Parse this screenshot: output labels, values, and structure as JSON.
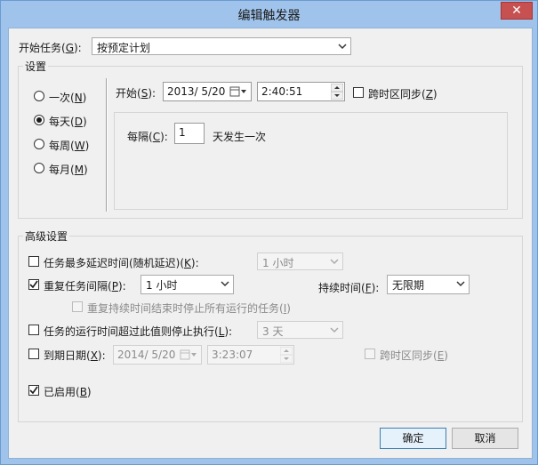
{
  "window": {
    "title": "编辑触发器",
    "close_glyph": "✕"
  },
  "begin_task": {
    "label": "开始任务(",
    "key": "G",
    "suffix": "):",
    "value": "按预定计划"
  },
  "settings": {
    "title": "设置",
    "radios": [
      {
        "label": "一次(",
        "key": "N",
        "suffix": ")",
        "checked": false
      },
      {
        "label": "每天(",
        "key": "D",
        "suffix": ")",
        "checked": true
      },
      {
        "label": "每周(",
        "key": "W",
        "suffix": ")",
        "checked": false
      },
      {
        "label": "每月(",
        "key": "M",
        "suffix": ")",
        "checked": false
      }
    ],
    "start": {
      "label": "开始(",
      "key": "S",
      "suffix": "):",
      "date": "2013/  5/20",
      "time": "2:40:51",
      "sync_label": "跨时区同步(",
      "sync_key": "Z",
      "sync_suffix": ")",
      "sync_checked": false
    },
    "recur": {
      "label": "每隔(",
      "key": "C",
      "suffix": "):",
      "value": "1",
      "unit": "天发生一次"
    }
  },
  "advanced": {
    "title": "高级设置",
    "delay": {
      "label": "任务最多延迟时间(随机延迟)(",
      "key": "K",
      "suffix": "):",
      "value": "1 小时",
      "checked": false
    },
    "repeat": {
      "label": "重复任务间隔(",
      "key": "P",
      "suffix": "):",
      "value": "1 小时",
      "checked": true,
      "duration_label": "持续时间(",
      "duration_key": "F",
      "duration_suffix": "):",
      "duration_value": "无限期"
    },
    "stop_running": {
      "label": "重复持续时间结束时停止所有运行的任务(",
      "key": "I",
      "suffix": ")",
      "checked": false
    },
    "stop_if_longer": {
      "label": "任务的运行时间超过此值则停止执行(",
      "key": "L",
      "suffix": "):",
      "value": "3 天",
      "checked": false
    },
    "expire": {
      "label": "到期日期(",
      "key": "X",
      "suffix": "):",
      "date": "2014/  5/20",
      "time": "3:23:07",
      "checked": false,
      "sync_label": "跨时区同步(",
      "sync_key": "E",
      "sync_suffix": ")"
    },
    "enabled": {
      "label": "已启用(",
      "key": "B",
      "suffix": ")",
      "checked": true
    }
  },
  "buttons": {
    "ok": "确定",
    "cancel": "取消"
  }
}
